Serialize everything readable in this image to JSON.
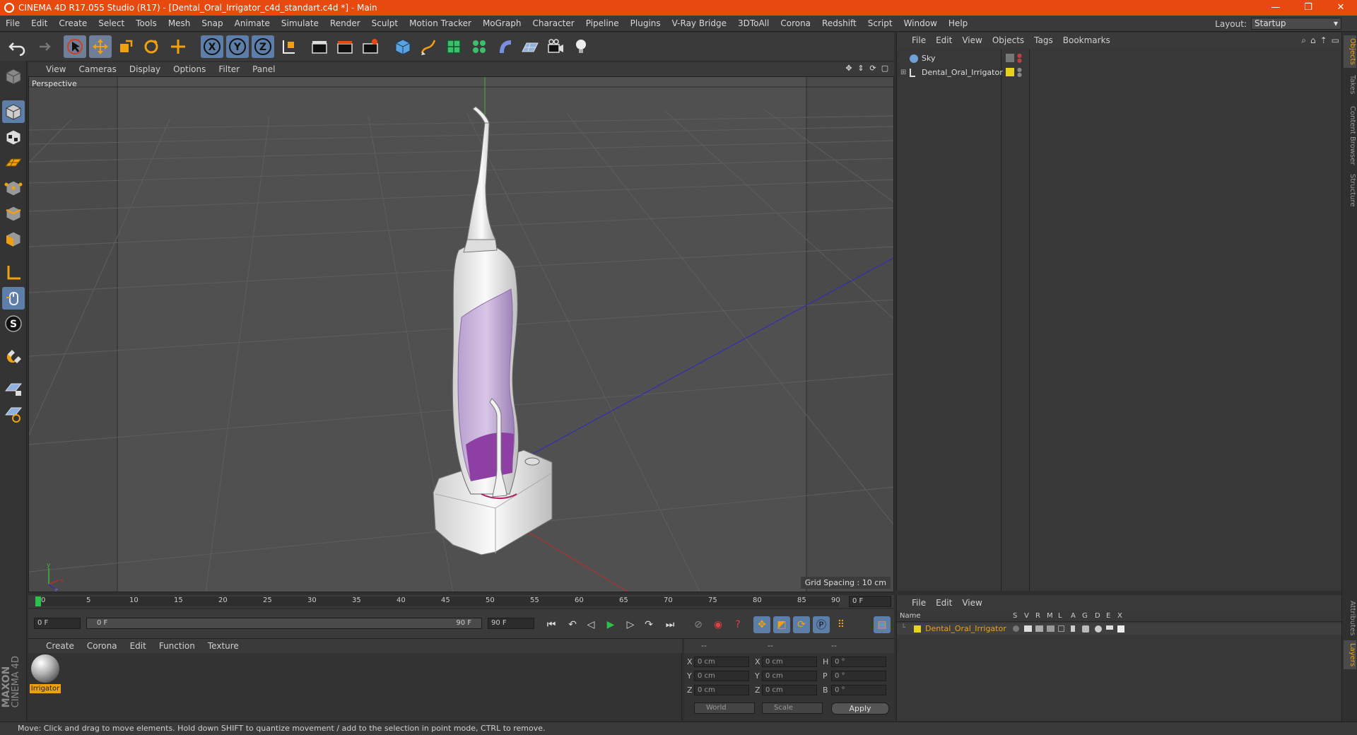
{
  "titlebar": {
    "title": "CINEMA 4D R17.055 Studio (R17) - [Dental_Oral_Irrigator_c4d_standart.c4d *] - Main",
    "minimize": "—",
    "maximize": "❐",
    "close": "✕"
  },
  "menu": [
    "File",
    "Edit",
    "Create",
    "Select",
    "Tools",
    "Mesh",
    "Snap",
    "Animate",
    "Simulate",
    "Render",
    "Sculpt",
    "Motion Tracker",
    "MoGraph",
    "Character",
    "Pipeline",
    "Plugins",
    "V-Ray Bridge",
    "3DToAll",
    "Corona",
    "Redshift",
    "Script",
    "Window",
    "Help"
  ],
  "layout": {
    "label": "Layout:",
    "value": "Startup"
  },
  "viewport": {
    "menu": [
      "View",
      "Cameras",
      "Display",
      "Options",
      "Filter",
      "Panel"
    ],
    "label": "Perspective",
    "grid_spacing": "Grid Spacing : 10 cm"
  },
  "timeline": {
    "ticks": [
      "0",
      "5",
      "10",
      "15",
      "20",
      "25",
      "30",
      "35",
      "40",
      "45",
      "50",
      "55",
      "60",
      "65",
      "70",
      "75",
      "80",
      "85",
      "90"
    ],
    "current_frame": "0 F",
    "start": "0 F",
    "range_start": "0 F",
    "range_end": "90 F",
    "end": "90 F"
  },
  "material_manager": {
    "menu": [
      "Create",
      "Corona",
      "Edit",
      "Function",
      "Texture"
    ],
    "material_name": "Irrigator"
  },
  "coordinates": {
    "headers": [
      "--",
      "--",
      "--"
    ],
    "rows": [
      {
        "l1": "X",
        "v1": "0 cm",
        "l2": "X",
        "v2": "0 cm",
        "l3": "H",
        "v3": "0 °"
      },
      {
        "l1": "Y",
        "v1": "0 cm",
        "l2": "Y",
        "v2": "0 cm",
        "l3": "P",
        "v3": "0 °"
      },
      {
        "l1": "Z",
        "v1": "0 cm",
        "l2": "Z",
        "v2": "0 cm",
        "l3": "B",
        "v3": "0 °"
      }
    ],
    "space": "World",
    "mode": "Scale",
    "apply": "Apply"
  },
  "statusbar": "Move: Click and drag to move elements. Hold down SHIFT to quantize movement / add to the selection in point mode, CTRL to remove.",
  "object_manager": {
    "menu": [
      "File",
      "Edit",
      "View",
      "Objects",
      "Tags",
      "Bookmarks"
    ],
    "objects": [
      {
        "name": "Sky"
      },
      {
        "name": "Dental_Oral_Irrigator"
      }
    ]
  },
  "layer_manager": {
    "menu": [
      "File",
      "Edit",
      "View"
    ],
    "columns": [
      "Name",
      "S",
      "V",
      "R",
      "M",
      "L",
      "A",
      "G",
      "D",
      "E",
      "X"
    ],
    "layer_name": "Dental_Oral_Irrigator",
    "layer_color": "#e8d21a"
  },
  "right_tabs": [
    "Objects",
    "Takes",
    "Content Browser",
    "Structure",
    "Attributes",
    "Layers"
  ],
  "maxon": {
    "brand": "MAXON",
    "product": "CINEMA 4D"
  },
  "colors": {
    "accent": "#e8490f",
    "highlight": "#f0a10f",
    "tool_selected": "#5d7ea8"
  }
}
